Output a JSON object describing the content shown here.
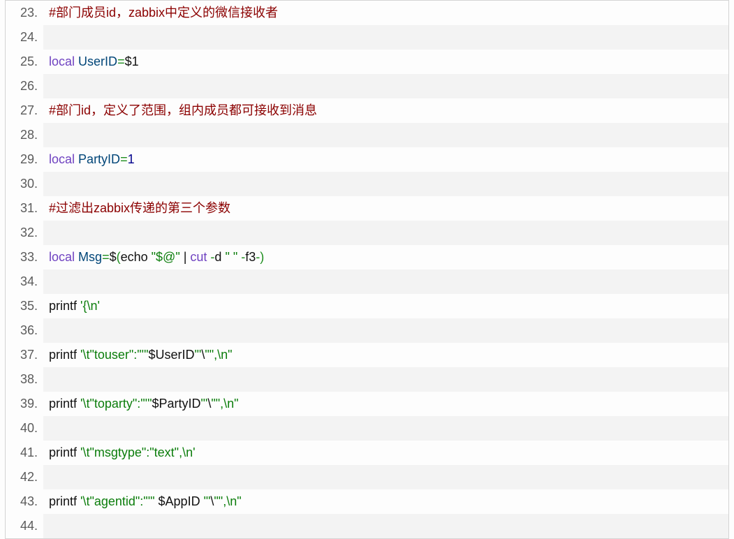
{
  "lines": [
    {
      "n": 23,
      "tokens": [
        {
          "t": "#部门成员id，zabbix中定义的微信接收者",
          "c": "tok-comment"
        }
      ]
    },
    {
      "n": 24,
      "tokens": []
    },
    {
      "n": 25,
      "tokens": [
        {
          "t": "local",
          "c": "tok-keyword"
        },
        {
          "t": " ",
          "c": "tok-plain"
        },
        {
          "t": "UserID",
          "c": "tok-var"
        },
        {
          "t": "=",
          "c": "tok-green"
        },
        {
          "t": "$1",
          "c": "tok-plain"
        }
      ]
    },
    {
      "n": 26,
      "tokens": []
    },
    {
      "n": 27,
      "tokens": [
        {
          "t": "#部门id，定义了范围，组内成员都可接收到消息",
          "c": "tok-comment"
        }
      ]
    },
    {
      "n": 28,
      "tokens": []
    },
    {
      "n": 29,
      "tokens": [
        {
          "t": "local",
          "c": "tok-keyword"
        },
        {
          "t": " ",
          "c": "tok-plain"
        },
        {
          "t": "PartyID",
          "c": "tok-var"
        },
        {
          "t": "=",
          "c": "tok-green"
        },
        {
          "t": "1",
          "c": "tok-num"
        }
      ]
    },
    {
      "n": 30,
      "tokens": []
    },
    {
      "n": 31,
      "tokens": [
        {
          "t": "#过滤出zabbix传递的第三个参数",
          "c": "tok-comment"
        }
      ]
    },
    {
      "n": 32,
      "tokens": []
    },
    {
      "n": 33,
      "tokens": [
        {
          "t": "local",
          "c": "tok-keyword"
        },
        {
          "t": " ",
          "c": "tok-plain"
        },
        {
          "t": "Msg",
          "c": "tok-var"
        },
        {
          "t": "=",
          "c": "tok-green"
        },
        {
          "t": "$",
          "c": "tok-plain"
        },
        {
          "t": "(",
          "c": "tok-green"
        },
        {
          "t": "echo ",
          "c": "tok-plain"
        },
        {
          "t": "\"$@\"",
          "c": "tok-string"
        },
        {
          "t": " | ",
          "c": "tok-plain"
        },
        {
          "t": "cut",
          "c": "tok-keyword"
        },
        {
          "t": " ",
          "c": "tok-plain"
        },
        {
          "t": "-",
          "c": "tok-green"
        },
        {
          "t": "d ",
          "c": "tok-plain"
        },
        {
          "t": "\" \"",
          "c": "tok-string"
        },
        {
          "t": " ",
          "c": "tok-plain"
        },
        {
          "t": "-",
          "c": "tok-green"
        },
        {
          "t": "f3",
          "c": "tok-plain"
        },
        {
          "t": "-",
          "c": "tok-green"
        },
        {
          "t": ")",
          "c": "tok-green"
        }
      ]
    },
    {
      "n": 34,
      "tokens": []
    },
    {
      "n": 35,
      "tokens": [
        {
          "t": "printf ",
          "c": "tok-plain"
        },
        {
          "t": "'{\\n'",
          "c": "tok-string"
        }
      ]
    },
    {
      "n": 36,
      "tokens": []
    },
    {
      "n": 37,
      "tokens": [
        {
          "t": "printf ",
          "c": "tok-plain"
        },
        {
          "t": "'\\t\"touser\":\"'\"",
          "c": "tok-string"
        },
        {
          "t": "$UserID",
          "c": "tok-plain"
        },
        {
          "t": "\"'",
          "c": "tok-string"
        },
        {
          "t": "\\",
          "c": "tok-plain"
        },
        {
          "t": "\"\",\\n\"",
          "c": "tok-string"
        }
      ]
    },
    {
      "n": 38,
      "tokens": []
    },
    {
      "n": 39,
      "tokens": [
        {
          "t": "printf ",
          "c": "tok-plain"
        },
        {
          "t": "'\\t\"toparty\":\"'\"",
          "c": "tok-string"
        },
        {
          "t": "$PartyID",
          "c": "tok-plain"
        },
        {
          "t": "\"'",
          "c": "tok-string"
        },
        {
          "t": "\\",
          "c": "tok-plain"
        },
        {
          "t": "\"\",\\n\"",
          "c": "tok-string"
        }
      ]
    },
    {
      "n": 40,
      "tokens": []
    },
    {
      "n": 41,
      "tokens": [
        {
          "t": "printf ",
          "c": "tok-plain"
        },
        {
          "t": "'\\t\"msgtype\":\"text\",\\n'",
          "c": "tok-string"
        }
      ]
    },
    {
      "n": 42,
      "tokens": []
    },
    {
      "n": 43,
      "tokens": [
        {
          "t": "printf ",
          "c": "tok-plain"
        },
        {
          "t": "'\\t\"agentid\":\"'\"",
          "c": "tok-string"
        },
        {
          "t": " $AppID ",
          "c": "tok-plain"
        },
        {
          "t": "\"'",
          "c": "tok-string"
        },
        {
          "t": "\\",
          "c": "tok-plain"
        },
        {
          "t": "\"\",\\n\"",
          "c": "tok-string"
        }
      ]
    },
    {
      "n": 44,
      "tokens": []
    }
  ]
}
